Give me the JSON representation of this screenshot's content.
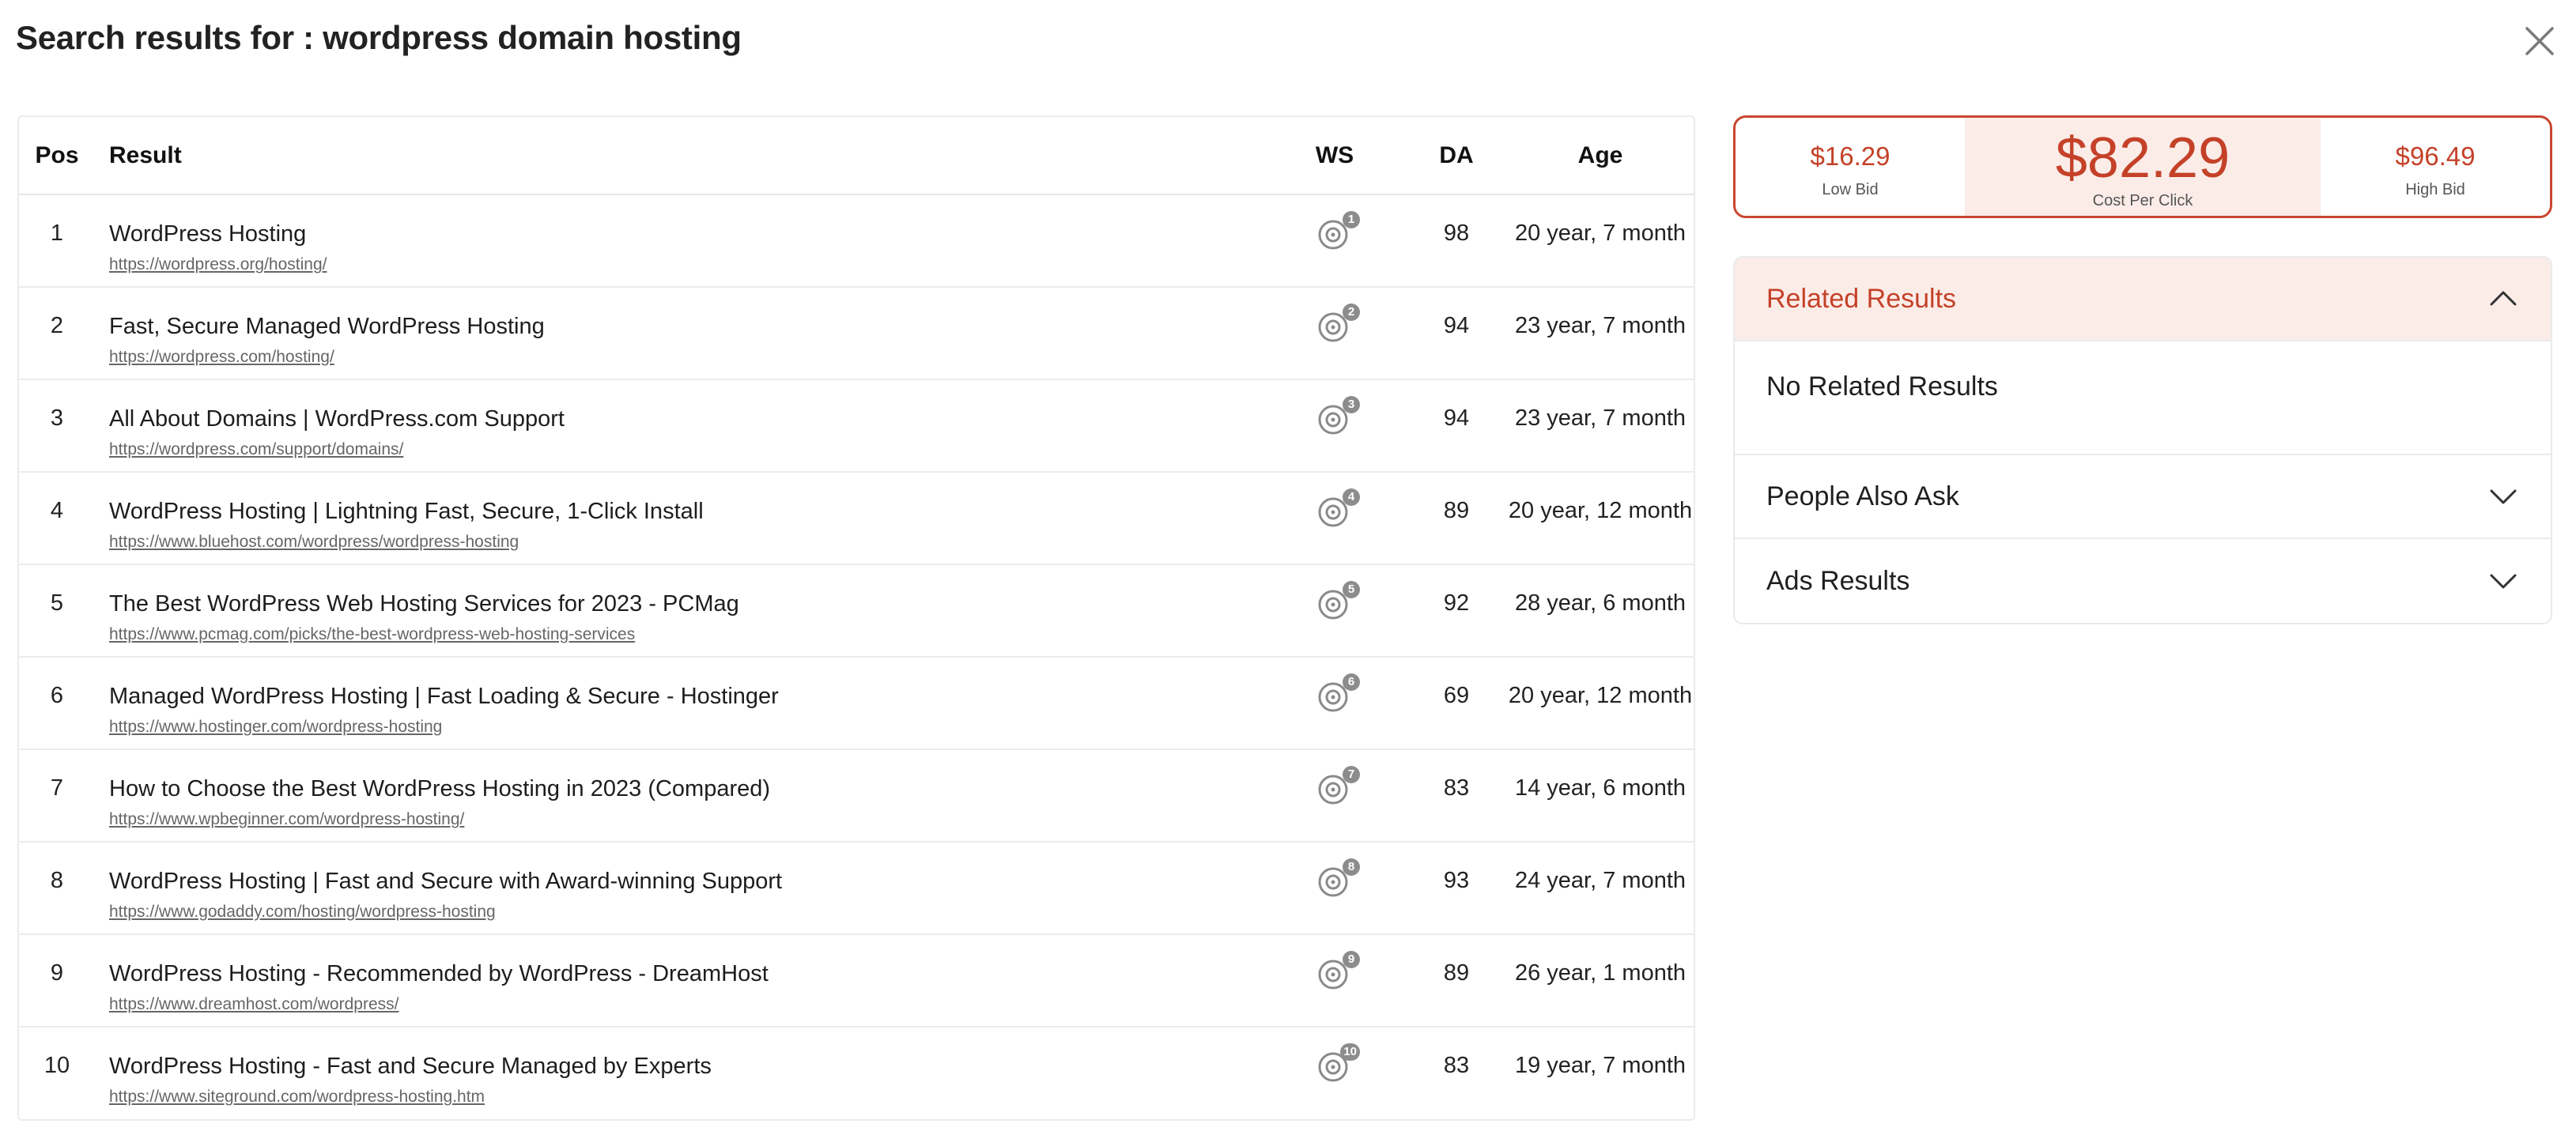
{
  "page": {
    "title": "Search results for : wordpress domain hosting"
  },
  "table": {
    "headers": {
      "pos": "Pos",
      "result": "Result",
      "ws": "WS",
      "da": "DA",
      "age": "Age"
    },
    "rows": [
      {
        "pos": "1",
        "title": "WordPress Hosting",
        "url": "https://wordpress.org/hosting/",
        "ws": "1",
        "da": "98",
        "age": "20 year, 7 month"
      },
      {
        "pos": "2",
        "title": "Fast, Secure Managed WordPress Hosting",
        "url": "https://wordpress.com/hosting/",
        "ws": "2",
        "da": "94",
        "age": "23 year, 7 month"
      },
      {
        "pos": "3",
        "title": "All About Domains | WordPress.com Support",
        "url": "https://wordpress.com/support/domains/",
        "ws": "3",
        "da": "94",
        "age": "23 year, 7 month"
      },
      {
        "pos": "4",
        "title": "WordPress Hosting | Lightning Fast, Secure, 1-Click Install",
        "url": "https://www.bluehost.com/wordpress/wordpress-hosting",
        "ws": "4",
        "da": "89",
        "age": "20 year, 12 month"
      },
      {
        "pos": "5",
        "title": "The Best WordPress Web Hosting Services for 2023 - PCMag",
        "url": "https://www.pcmag.com/picks/the-best-wordpress-web-hosting-services",
        "ws": "5",
        "da": "92",
        "age": "28 year, 6 month"
      },
      {
        "pos": "6",
        "title": "Managed WordPress Hosting | Fast Loading & Secure - Hostinger",
        "url": "https://www.hostinger.com/wordpress-hosting",
        "ws": "6",
        "da": "69",
        "age": "20 year, 12 month"
      },
      {
        "pos": "7",
        "title": "How to Choose the Best WordPress Hosting in 2023 (Compared)",
        "url": "https://www.wpbeginner.com/wordpress-hosting/",
        "ws": "7",
        "da": "83",
        "age": "14 year, 6 month"
      },
      {
        "pos": "8",
        "title": "WordPress Hosting | Fast and Secure with Award-winning Support",
        "url": "https://www.godaddy.com/hosting/wordpress-hosting",
        "ws": "8",
        "da": "93",
        "age": "24 year, 7 month"
      },
      {
        "pos": "9",
        "title": "WordPress Hosting - Recommended by WordPress - DreamHost",
        "url": "https://www.dreamhost.com/wordpress/",
        "ws": "9",
        "da": "89",
        "age": "26 year, 1 month"
      },
      {
        "pos": "10",
        "title": "WordPress Hosting - Fast and Secure Managed by Experts",
        "url": "https://www.siteground.com/wordpress-hosting.htm",
        "ws": "10",
        "da": "83",
        "age": "19 year, 7 month"
      }
    ]
  },
  "cpc": {
    "low_value": "$16.29",
    "low_label": "Low Bid",
    "main_value": "$82.29",
    "main_label": "Cost Per Click",
    "high_value": "$96.49",
    "high_label": "High Bid"
  },
  "accordion": {
    "related_title": "Related Results",
    "related_body": "No Related Results",
    "people_title": "People Also Ask",
    "ads_title": "Ads Results"
  },
  "icons": {
    "close": "close-icon",
    "ws": "target-icon",
    "chevron_up": "chevron-up-icon",
    "chevron_down": "chevron-down-icon"
  },
  "colors": {
    "accent": "#c44128",
    "accent_bg": "#fbece8",
    "badge": "#8c8c8c"
  }
}
